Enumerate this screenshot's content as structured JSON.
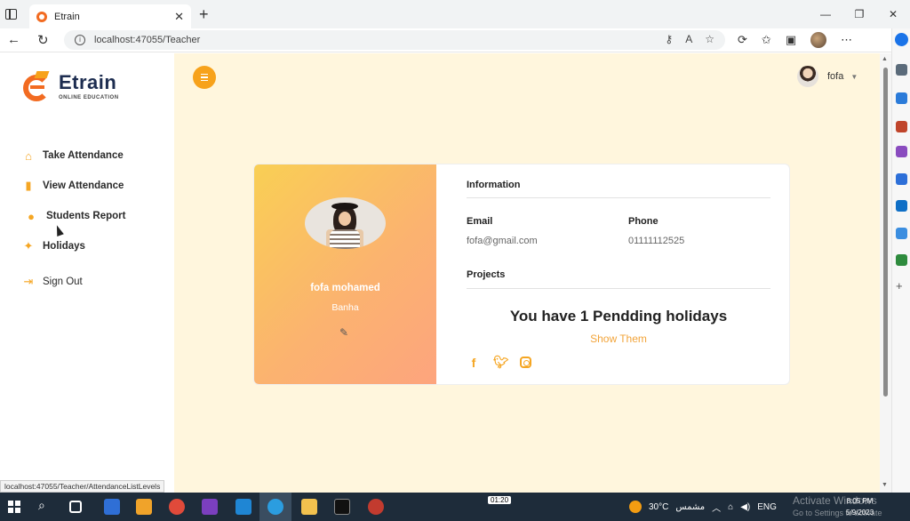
{
  "browser": {
    "tab_title": "Etrain",
    "url": "localhost:47055/Teacher",
    "window_controls": [
      "—",
      "❐",
      "✕"
    ]
  },
  "sidebar": {
    "logo_name": "Etrain",
    "logo_subtitle": "ONLINE EDUCATION",
    "items": [
      {
        "label": "Take Attendance",
        "icon": "home-icon"
      },
      {
        "label": "View Attendance",
        "icon": "badge-icon"
      },
      {
        "label": "Students Report",
        "icon": "chat-bubbles-icon"
      },
      {
        "label": "Holidays",
        "icon": "magic-wand-icon"
      },
      {
        "label": "Sign Out",
        "icon": "sign-out-icon"
      }
    ]
  },
  "header": {
    "user_name": "fofa"
  },
  "profile": {
    "name": "fofa mohamed",
    "city": "Banha"
  },
  "info": {
    "section_title": "Information",
    "email_label": "Email",
    "email_value": "fofa@gmail.com",
    "phone_label": "Phone",
    "phone_value": "01111112525",
    "projects_title": "Projects",
    "holiday_message": "You have 1 Pendding holidays",
    "show_link": "Show Them"
  },
  "socials": [
    "facebook-icon",
    "twitter-icon",
    "instagram-icon"
  ],
  "status_link": "localhost:47055/Teacher/AttendanceListLevels",
  "taskbar": {
    "video_time": "01:20",
    "weather": "30°C",
    "weather_text": "مشمس",
    "lang": "ENG",
    "clock_time": "8:05 PM",
    "clock_date": "5/9/2023",
    "watermark_line1": "Activate Windows",
    "watermark_line2": "Go to Settings to activate"
  },
  "colors": {
    "accent": "#f5a623",
    "page_bg": "#fff6dd",
    "card_gradient_start": "#f9cf54",
    "card_gradient_end": "#fda47e",
    "logo_orange": "#f26b21",
    "taskbar": "#1e2c3a"
  }
}
